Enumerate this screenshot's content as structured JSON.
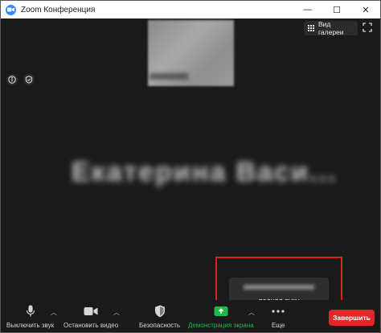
{
  "window": {
    "title": "Zoom Конференция",
    "controls": {
      "minimize": "—",
      "maximize": "☐",
      "close": "✕"
    }
  },
  "meeting": {
    "gallery_button_label": "Вид галереи",
    "active_speaker_name": "Екатерина Васи...",
    "notification": {
      "text": "поднял руку"
    }
  },
  "toolbar": {
    "items": [
      {
        "label": "Выключить звук",
        "icon": "microphone-icon"
      },
      {
        "label": "Остановить видео",
        "icon": "video-camera-icon"
      },
      {
        "label": "Безопасность",
        "icon": "shield-icon"
      },
      {
        "label": "Демонстрация экрана",
        "icon": "share-screen-icon"
      },
      {
        "label": "Еще",
        "icon": "more-icon"
      }
    ],
    "end_button_label": "Завершить"
  },
  "colors": {
    "background": "#1a1a1a",
    "share_green": "#21b84b",
    "end_red": "#e02828",
    "highlight_red": "#e02020",
    "zoom_blue": "#2d8cff"
  }
}
